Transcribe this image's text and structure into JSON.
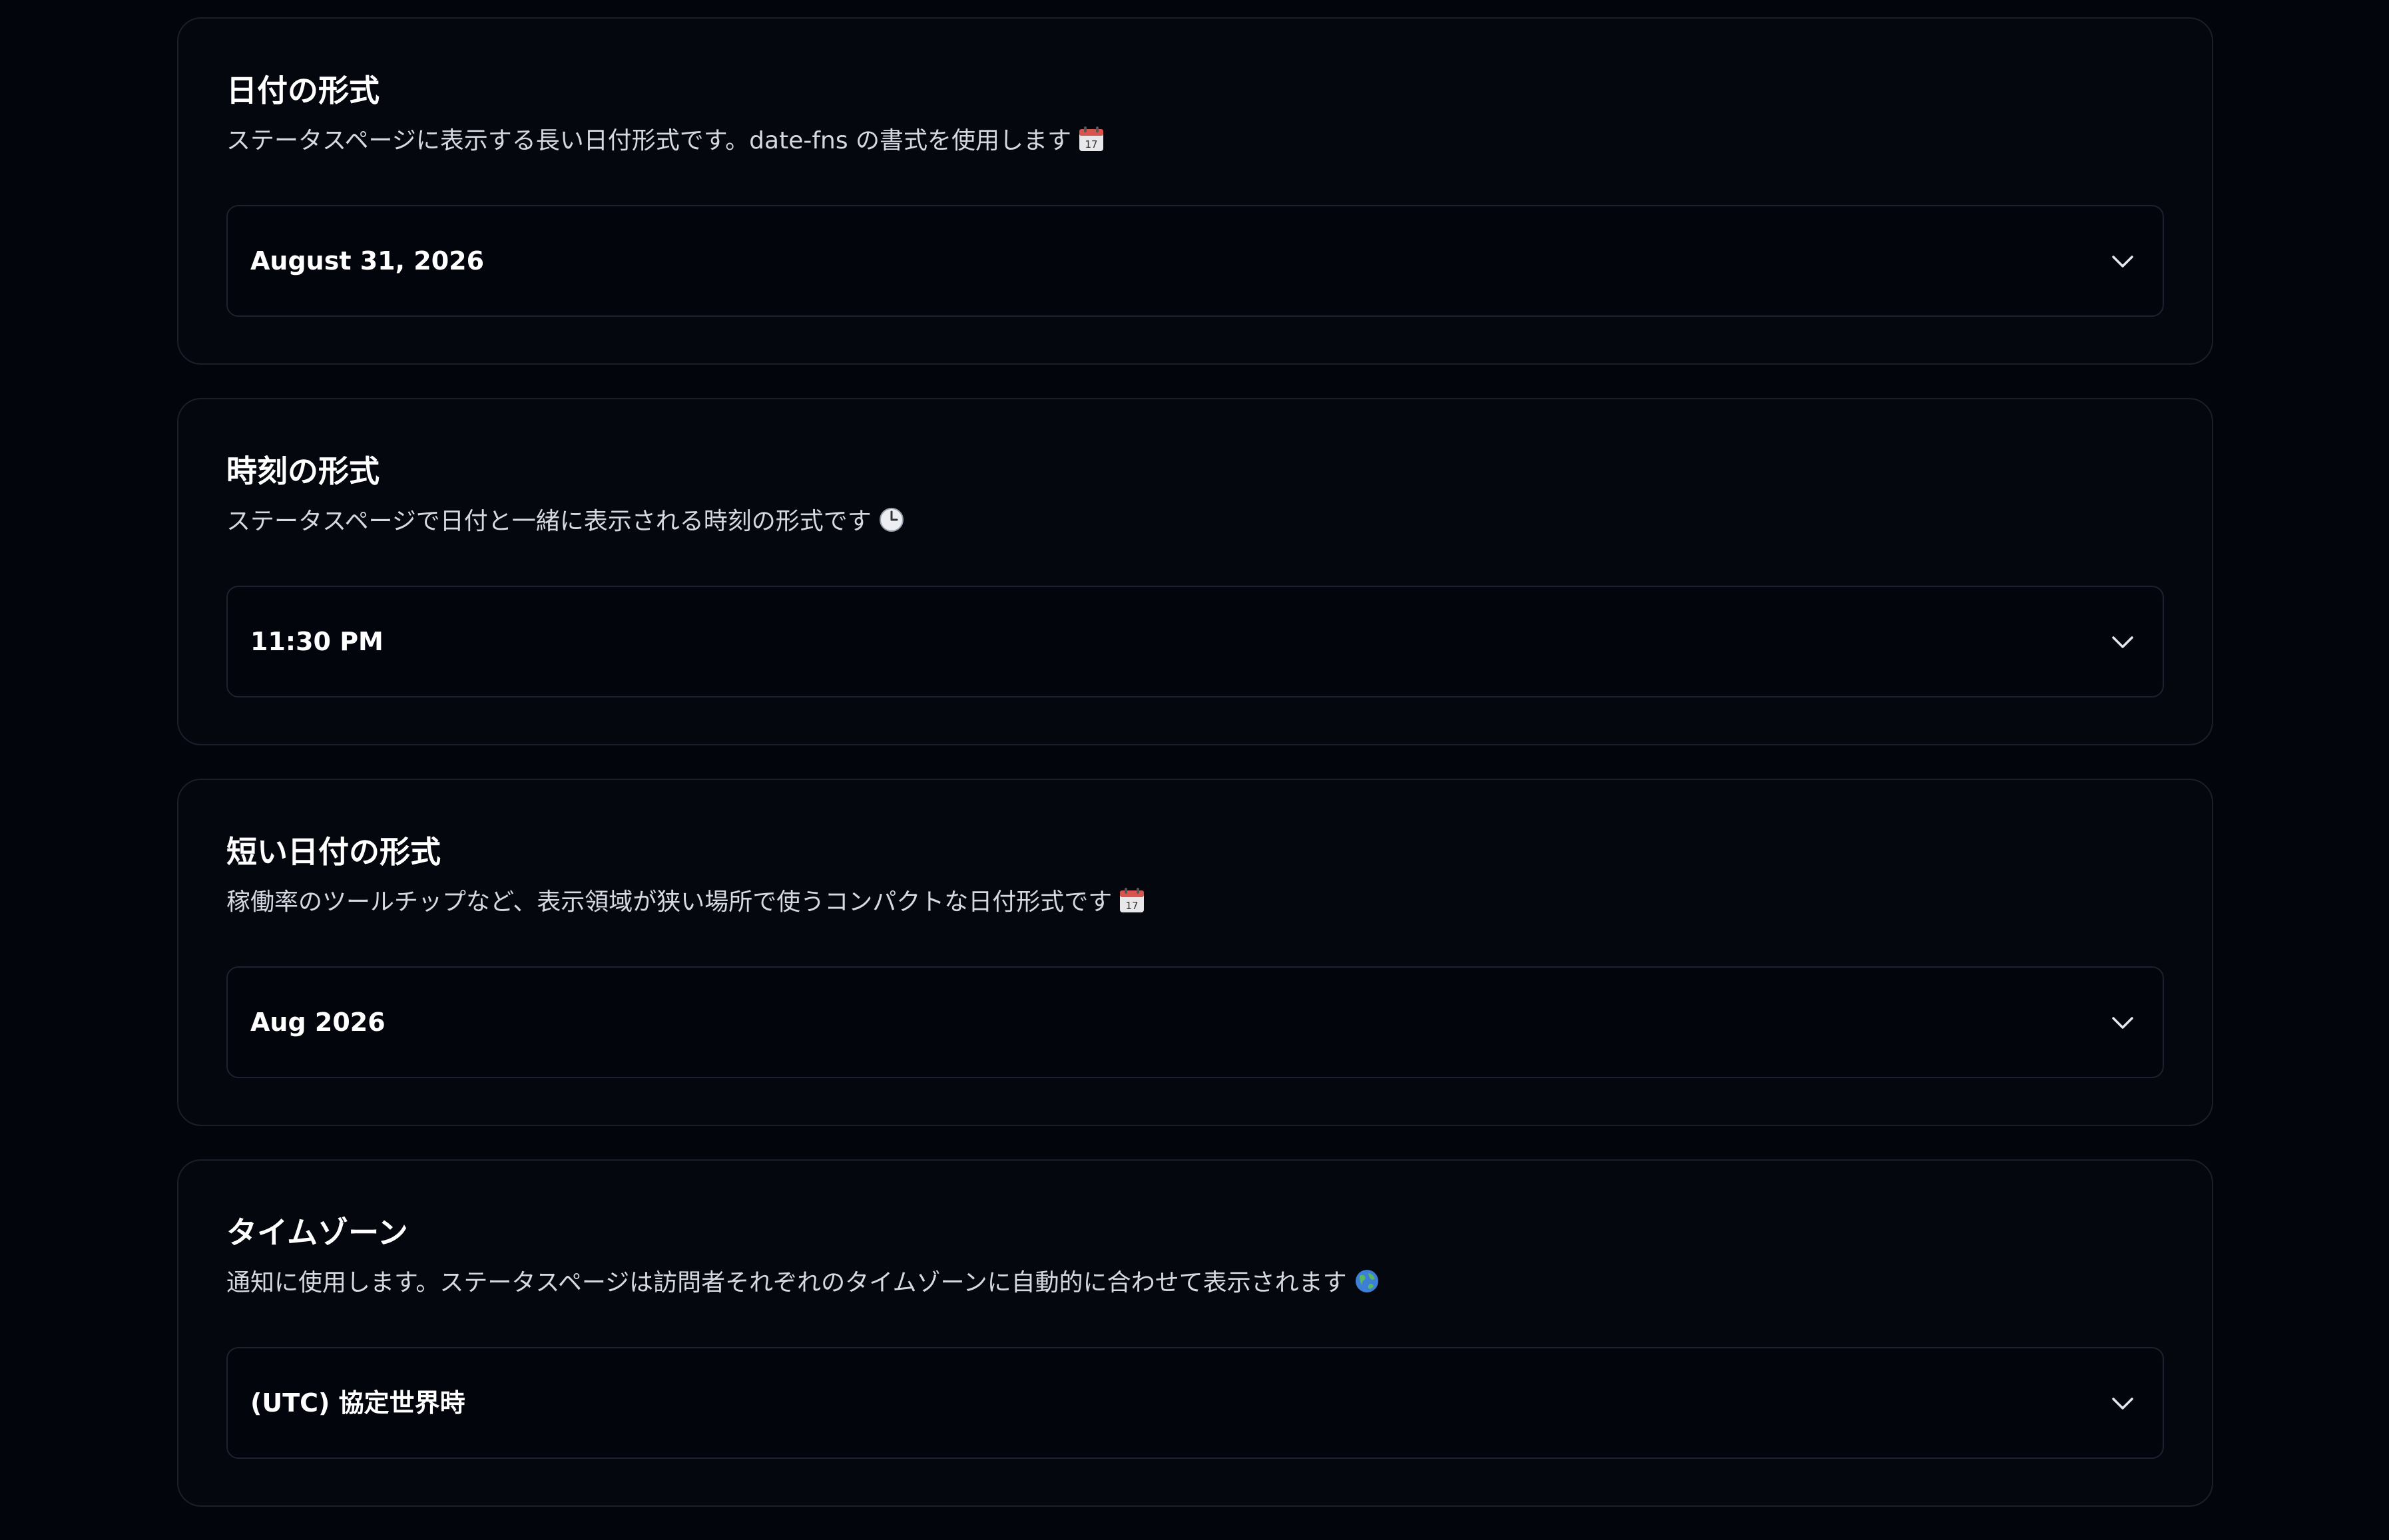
{
  "cards": [
    {
      "title": "日付の形式",
      "description": "ステータスページに表示する長い日付形式です。date-fns の書式を使用します",
      "emoji": "calendar-icon",
      "value": "August 31, 2026"
    },
    {
      "title": "時刻の形式",
      "description": "ステータスページで日付と一緒に表示される時刻の形式です",
      "emoji": "clock-icon",
      "value": "11:30 PM"
    },
    {
      "title": "短い日付の形式",
      "description": "稼働率のツールチップなど、表示領域が狭い場所で使うコンパクトな日付形式です",
      "emoji": "calendar-icon",
      "value": "Aug 2026"
    },
    {
      "title": "タイムゾーン",
      "description": "通知に使用します。ステータスページは訪問者それぞれのタイムゾーンに自動的に合わせて表示されます",
      "emoji": "globe-icon",
      "value": "(UTC) 協定世界時"
    }
  ],
  "colors": {
    "background": "#03050d",
    "card_border": "#1b1f2b",
    "text_primary": "#ffffff",
    "text_secondary": "#d6d9e1"
  }
}
